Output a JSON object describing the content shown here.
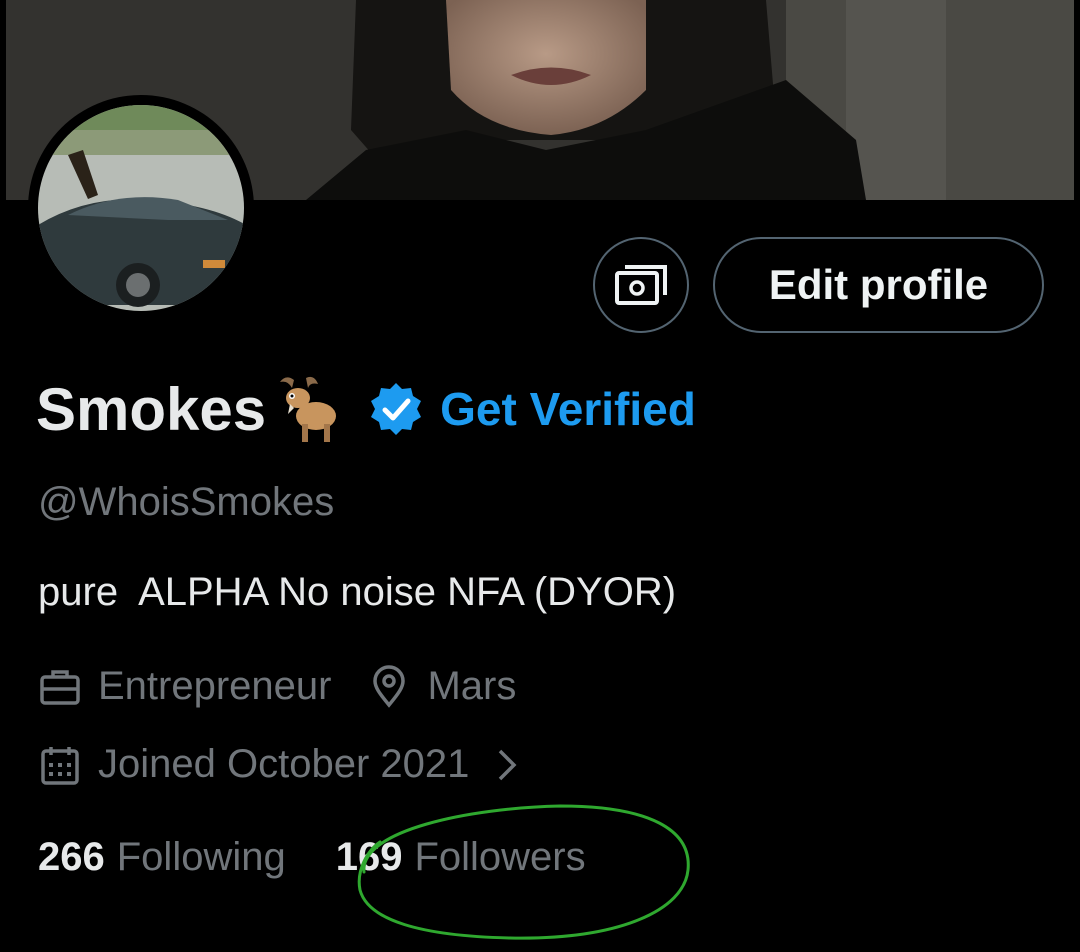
{
  "profile": {
    "name": "Smokes",
    "get_verified_label": "Get Verified",
    "handle": "@WhoisSmokes",
    "bio": "pure  ALPHA No noise NFA (DYOR)",
    "occupation": "Entrepreneur",
    "location": "Mars",
    "joined": "Joined October 2021"
  },
  "buttons": {
    "edit_profile": "Edit profile"
  },
  "stats": {
    "following_count": "266",
    "following_label": "Following",
    "followers_count": "169",
    "followers_label": "Followers"
  },
  "colors": {
    "accent": "#1d9bf0",
    "muted_text": "#71767b",
    "annotation": "#2fa82f"
  },
  "icons": [
    "money-icon",
    "goat-emoji-icon",
    "verified-badge-icon",
    "briefcase-icon",
    "location-pin-icon",
    "calendar-icon",
    "chevron-right-icon"
  ]
}
